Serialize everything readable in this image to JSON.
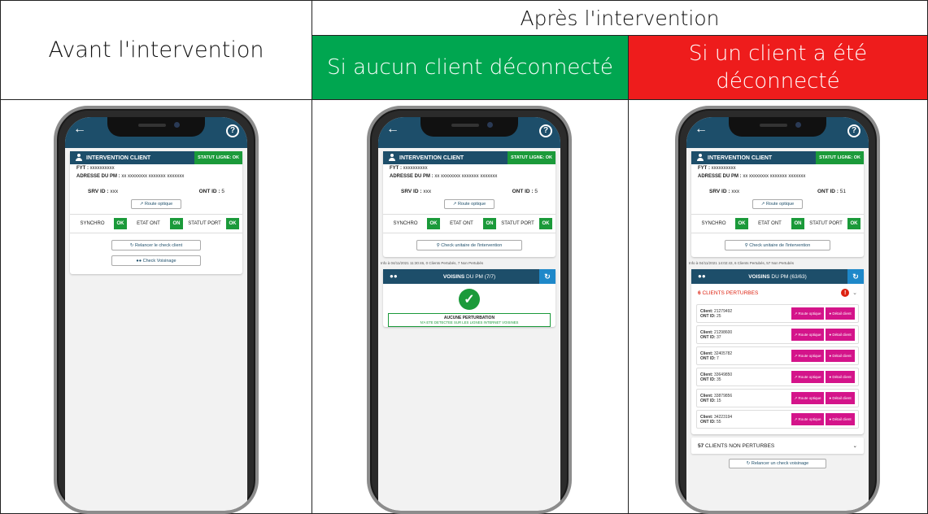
{
  "headers": {
    "avant": "Avant l'intervention",
    "apres": "Après l'intervention",
    "ok": "Si aucun client déconnecté",
    "ko": "Si un client a été déconnecté"
  },
  "colors": {
    "ok_bg": "#00a650",
    "ko_bg": "#ee1c1c",
    "app_primary": "#1d4e6a",
    "status_green": "#1b9a3a",
    "magenta": "#d4148a"
  },
  "app": {
    "card_title": "INTERVENTION CLIENT",
    "statut_ligne": "STATUT LIGNE: OK",
    "fyt_label": "FYT :",
    "fyt_value": "xxxxxxxxxx",
    "pm_label": "ADRESSE DU PM :",
    "pm_value": "xx xxxxxxxx xxxxxxx xxxxxxx",
    "srv_label": "SRV ID :",
    "srv_value": "xxx",
    "ont_label": "ONT ID :",
    "route_optique": "Route optique",
    "synchro": "SYNCHRO",
    "etat_ont": "ETAT ONT",
    "statut_port": "STATUT PORT",
    "ok": "OK",
    "on": "ON",
    "check_unitaire": "Check unitaire de l'intervention",
    "voisins_label": "VOISINS",
    "du_pm": "DU PM"
  },
  "phone1": {
    "ont_value": "5",
    "relancer": "Relancer le check client",
    "check_voisinage": "Check Voisinage"
  },
  "phone2": {
    "ont_value": "5",
    "info": "Info à 04/11/2021 11:30:46, 0 Clients Pertubés, 7 Non Pertubés",
    "voisins_count": "(7/7)",
    "no_pert_1": "AUCUNE PERTURBATION",
    "no_pert_2": "N'A ETE DETECTEE SUR LES LIGNES INTERNET VOISINES"
  },
  "phone3": {
    "ont_value": "51",
    "info": "Info à 04/11/2021 14:02:43, 6 Clients Pertubés, 57 Non Pertubés",
    "voisins_count": "(63/63)",
    "perturbes_count": "6",
    "perturbes_label": "CLIENTS PERTURBES",
    "non_perturbes_count": "57",
    "non_perturbes_label": "CLIENTS NON PERTURBES",
    "client_label": "Client:",
    "ont_id_label": "ONT ID:",
    "route_btn": "Route optique",
    "detail_btn": "Détail client",
    "relancer_voisinage": "Relancer un check voisinage",
    "clients": [
      {
        "client": "21279492",
        "ont": "25"
      },
      {
        "client": "21298600",
        "ont": "37"
      },
      {
        "client": "32405782",
        "ont": "7"
      },
      {
        "client": "33649850",
        "ont": "35"
      },
      {
        "client": "33879856",
        "ont": "15"
      },
      {
        "client": "34223194",
        "ont": "55"
      }
    ]
  }
}
